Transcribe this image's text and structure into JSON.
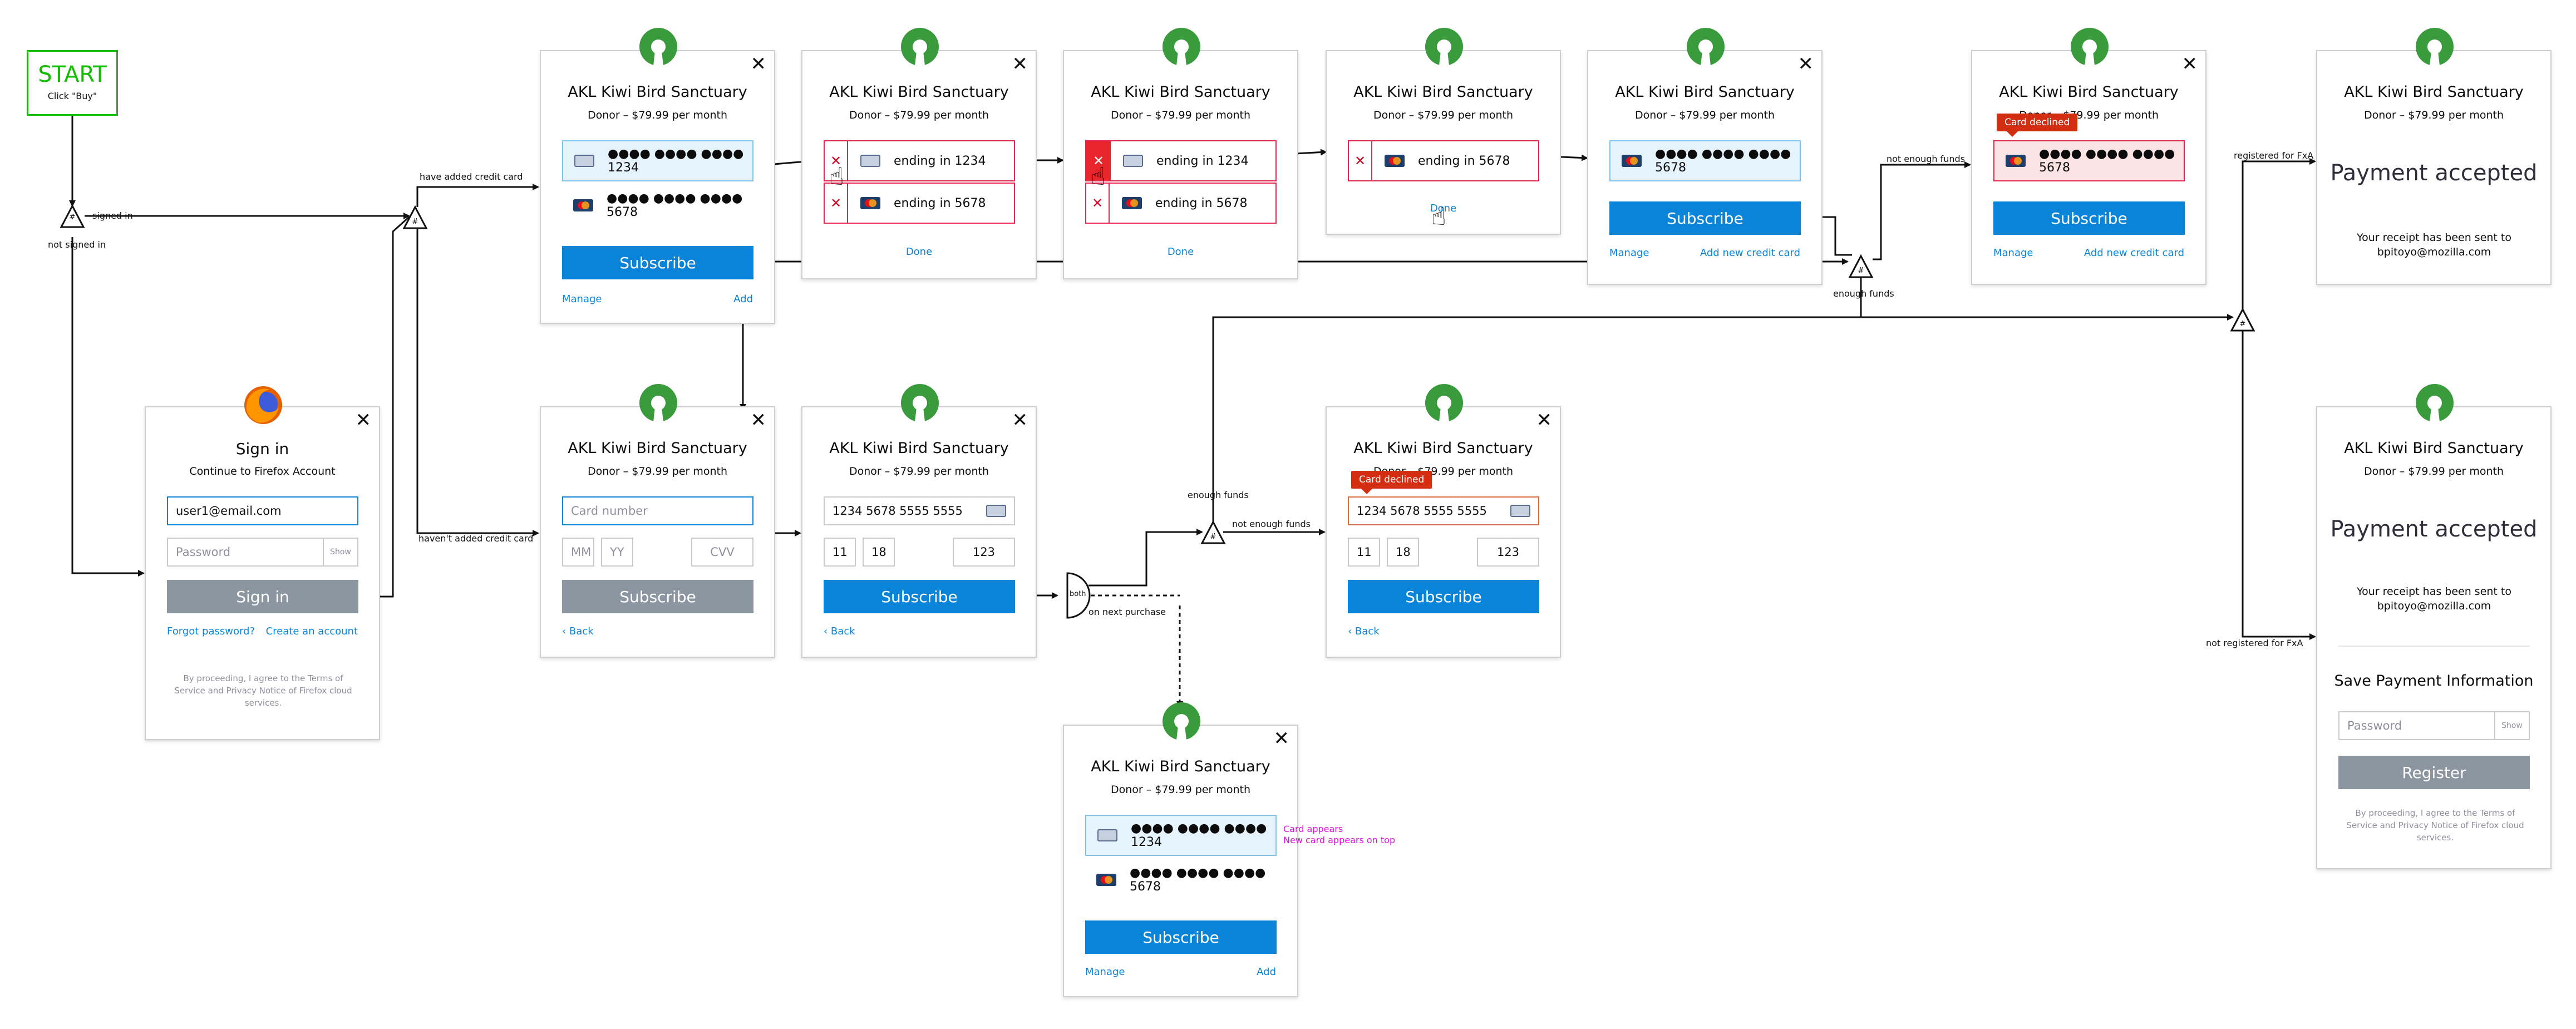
{
  "start": {
    "title": "START",
    "subtitle": "Click \"Buy\""
  },
  "product": {
    "name": "AKL Kiwi Bird Sanctuary",
    "price": "Donor – $79.99 per month"
  },
  "cards": {
    "masked_1234": "●●●● ●●●● ●●●● 1234",
    "masked_5678": "●●●● ●●●● ●●●● 5678",
    "ending_1234": "ending in 1234",
    "ending_5678": "ending in 5678"
  },
  "labels": {
    "subscribe": "Subscribe",
    "manage": "Manage",
    "add": "Add",
    "done": "Done",
    "add_new_card": "Add new credit card",
    "back": "Back",
    "close": "✕",
    "card_declined": "Card declined"
  },
  "signin": {
    "title": "Sign in",
    "subtitle": "Continue to Firefox Account",
    "email": "user1@email.com",
    "password_placeholder": "Password",
    "show": "Show",
    "button": "Sign in",
    "forgot": "Forgot password?",
    "create": "Create an account",
    "legal": "By proceeding, I agree to the Terms of Service and Privacy Notice of Firefox cloud services."
  },
  "new_card": {
    "number_placeholder": "Card number",
    "mm": "MM",
    "yy": "YY",
    "cvv": "CVV",
    "number": "1234 5678 5555 5555",
    "month": "11",
    "year": "18",
    "code": "123"
  },
  "accepted": {
    "title": "Payment accepted",
    "receipt": "Your receipt has been sent to bpitoyo@mozilla.com",
    "save_title": "Save Payment Information",
    "password_placeholder": "Password",
    "show": "Show",
    "register": "Register",
    "legal": "By proceeding, I agree to the Terms of Service and Privacy Notice of Firefox cloud services."
  },
  "edges": {
    "signed_in": "signed in",
    "not_signed_in": "not signed in",
    "have_added": "have added credit card",
    "havent_added": "haven't added credit card",
    "not_enough_funds": "not enough funds",
    "enough_funds": "enough funds",
    "registered": "registered for FxA",
    "not_registered": "not registered for FxA",
    "both": "both",
    "on_next_purchase": "on next purchase"
  },
  "annotation": {
    "line1": "Card appears",
    "line2": "New card appears on top"
  },
  "colors": {
    "accent": "#0a84d8",
    "error": "#d70022",
    "start": "#12bc00",
    "annotation": "#e010e0",
    "logo": "#3a9b3c"
  }
}
